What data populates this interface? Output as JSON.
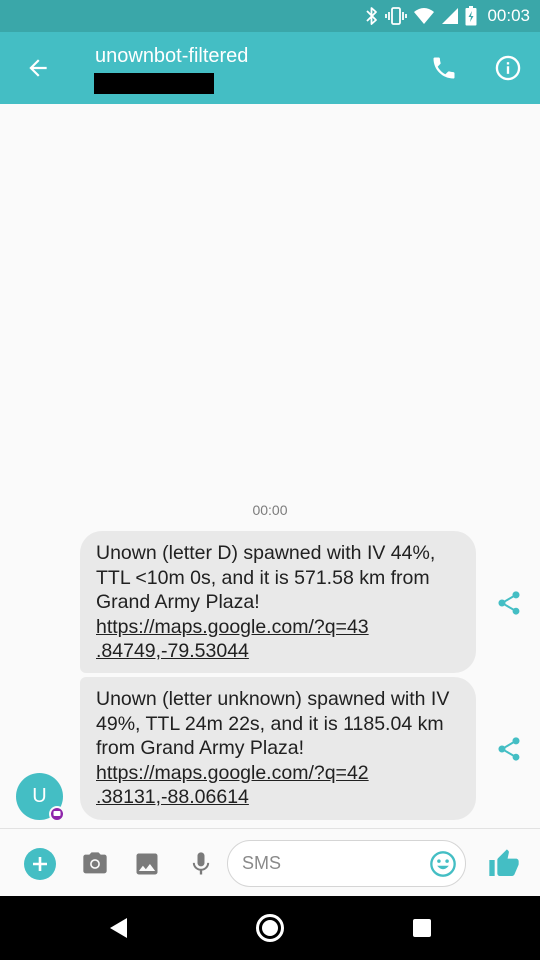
{
  "status_bar": {
    "time": "00:03",
    "icons": [
      "bluetooth-icon",
      "vibrate-icon",
      "wifi-icon",
      "signal-icon",
      "battery-icon"
    ]
  },
  "app_bar": {
    "title": "unownbot-filtered",
    "subtitle_redacted": true,
    "icons": [
      "back-arrow-icon",
      "phone-icon",
      "info-icon"
    ]
  },
  "conversation": {
    "timestamp": "00:00",
    "messages": [
      {
        "text": "Unown (letter D) spawned with IV 44%, TTL <10m 0s, and it is 571.58 km from Grand Army Plaza!",
        "link_line1": "https://maps.google.com/?q=43",
        "link_line2": ".84749,-79.53044"
      },
      {
        "text": "Unown (letter unknown) spawned with IV 49%, TTL 24m 22s, and it is 1185.04 km from Grand Army Plaza!",
        "link_line1": "https://maps.google.com/?q=42",
        "link_line2": ".38131,-88.06614"
      }
    ],
    "avatar_letter": "U"
  },
  "compose": {
    "placeholder": "SMS",
    "value": "",
    "icons": [
      "add-icon",
      "camera-icon",
      "gallery-icon",
      "mic-icon",
      "emoji-icon",
      "thumbs-up-icon"
    ]
  },
  "nav_bar": {
    "icons": [
      "nav-back-icon",
      "nav-home-icon",
      "nav-recents-icon"
    ]
  },
  "colors": {
    "app_bar": "#44bec4",
    "status_bar": "#3aa7a9",
    "accent": "#44bec4",
    "bubble": "#e9e9e9",
    "badge": "#8e24aa"
  }
}
